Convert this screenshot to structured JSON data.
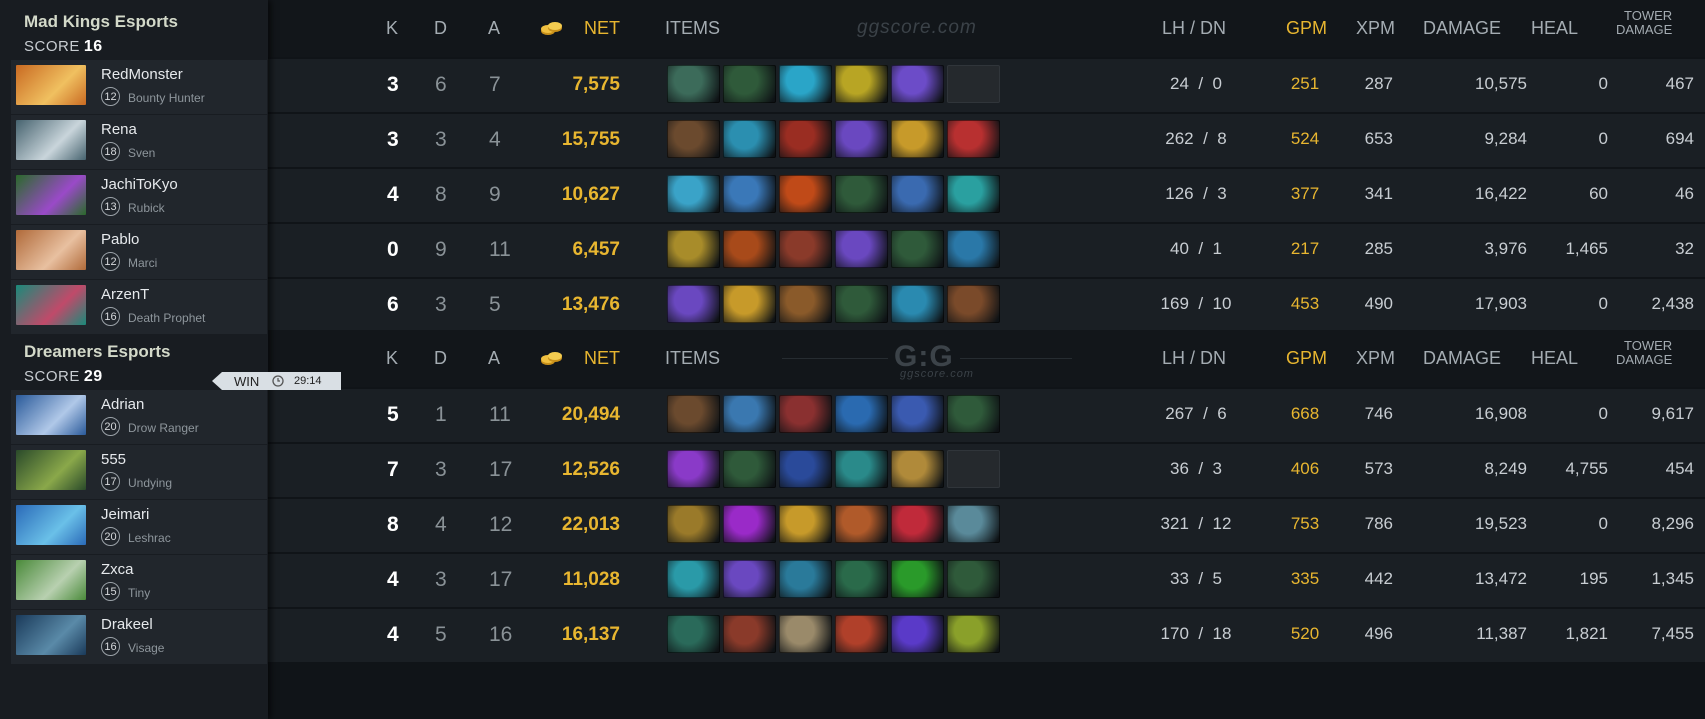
{
  "headers": {
    "k": "K",
    "d": "D",
    "a": "A",
    "net": "NET",
    "items": "ITEMS",
    "lhdn": "LH  /  DN",
    "gpm": "GPM",
    "xpm": "XPM",
    "damage": "DAMAGE",
    "heal": "HEAL",
    "tower1": "TOWER",
    "tower2": "DAMAGE"
  },
  "watermark_top": "ggscore.com",
  "watermark_logo": "G:G",
  "watermark_sub": "ggscore.com",
  "colors": {
    "gold": "#e8b630",
    "background": "#101418",
    "row": "#1a1f24"
  },
  "teams": [
    {
      "name": "Mad Kings Esports",
      "score_label": "SCORE",
      "score": "16",
      "players": [
        {
          "name": "RedMonster",
          "level": "12",
          "hero": "Bounty Hunter",
          "k": "3",
          "d": "6",
          "a": "7",
          "net": "7,575",
          "lh": "24",
          "dn": "0",
          "gpm": "251",
          "xpm": "287",
          "damage": "10,575",
          "heal": "0",
          "tower": "467",
          "items": [
            "#3c6b5a",
            "#2f5a3a",
            "#2aa5c8",
            "#b8a524",
            "#6c4cc8",
            "empty"
          ],
          "portrait": [
            "#c96a22",
            "#f0c060"
          ]
        },
        {
          "name": "Rena",
          "level": "18",
          "hero": "Sven",
          "k": "3",
          "d": "3",
          "a": "4",
          "net": "15,755",
          "lh": "262",
          "dn": "8",
          "gpm": "524",
          "xpm": "653",
          "damage": "9,284",
          "heal": "0",
          "tower": "694",
          "items": [
            "#6b4a2e",
            "#2b8fb0",
            "#9a2d22",
            "#6a48c0",
            "#c79a2a",
            "#b83030"
          ],
          "portrait": [
            "#46636f",
            "#c9d5db"
          ]
        },
        {
          "name": "JachiToKyo",
          "level": "13",
          "hero": "Rubick",
          "k": "4",
          "d": "8",
          "a": "9",
          "net": "10,627",
          "lh": "126",
          "dn": "3",
          "gpm": "377",
          "xpm": "341",
          "damage": "16,422",
          "heal": "60",
          "tower": "46",
          "items": [
            "#3aa3c8",
            "#3a78b8",
            "#c04a18",
            "#2f5a3a",
            "#3a6ab0",
            "#2aa0a0"
          ],
          "portrait": [
            "#2a6a2a",
            "#9a4ac8"
          ]
        },
        {
          "name": "Pablo",
          "level": "12",
          "hero": "Marci",
          "k": "0",
          "d": "9",
          "a": "11",
          "net": "6,457",
          "lh": "40",
          "dn": "1",
          "gpm": "217",
          "xpm": "285",
          "damage": "3,976",
          "heal": "1,465",
          "tower": "32",
          "items": [
            "#a88c2a",
            "#a84a1a",
            "#8a3a2a",
            "#6a48c0",
            "#2f5a3a",
            "#2a78a8"
          ],
          "portrait": [
            "#b06a3a",
            "#e8c0a0"
          ]
        },
        {
          "name": "ArzenT",
          "level": "16",
          "hero": "Death Prophet",
          "k": "6",
          "d": "3",
          "a": "5",
          "net": "13,476",
          "lh": "169",
          "dn": "10",
          "gpm": "453",
          "xpm": "490",
          "damage": "17,903",
          "heal": "0",
          "tower": "2,438",
          "items": [
            "#6a48c0",
            "#c79a2a",
            "#8a5a2a",
            "#2f5a3a",
            "#2a8ab0",
            "#7a4a2a"
          ],
          "portrait": [
            "#1a8a7a",
            "#c04a6a"
          ]
        }
      ]
    },
    {
      "name": "Dreamers Esports",
      "score_label": "SCORE",
      "score": "29",
      "result": "WIN",
      "duration": "29:14",
      "players": [
        {
          "name": "Adrian",
          "level": "20",
          "hero": "Drow Ranger",
          "k": "5",
          "d": "1",
          "a": "11",
          "net": "20,494",
          "lh": "267",
          "dn": "6",
          "gpm": "668",
          "xpm": "746",
          "damage": "16,908",
          "heal": "0",
          "tower": "9,617",
          "items": [
            "#6b4a2e",
            "#3a78b0",
            "#8a3030",
            "#2a6ab0",
            "#3a5ab0",
            "#2f5a3a"
          ],
          "portrait": [
            "#2a5a9a",
            "#b0c8e8"
          ]
        },
        {
          "name": "555",
          "level": "17",
          "hero": "Undying",
          "k": "7",
          "d": "3",
          "a": "17",
          "net": "12,526",
          "lh": "36",
          "dn": "3",
          "gpm": "406",
          "xpm": "573",
          "damage": "8,249",
          "heal": "4,755",
          "tower": "454",
          "items": [
            "#8a3ac8",
            "#2f5a3a",
            "#2a4a9a",
            "#2a8a8a",
            "#b08a3a",
            "empty"
          ],
          "portrait": [
            "#2a4a2a",
            "#8aa84a"
          ]
        },
        {
          "name": "Jeimari",
          "level": "20",
          "hero": "Leshrac",
          "k": "8",
          "d": "4",
          "a": "12",
          "net": "22,013",
          "lh": "321",
          "dn": "12",
          "gpm": "753",
          "xpm": "786",
          "damage": "19,523",
          "heal": "0",
          "tower": "8,296",
          "items": [
            "#9a7a2a",
            "#9a2ac8",
            "#c79a2a",
            "#b05a2a",
            "#c02a3a",
            "#5a8a9a"
          ],
          "portrait": [
            "#2a6ab8",
            "#6ac0e8"
          ]
        },
        {
          "name": "Zxca",
          "level": "15",
          "hero": "Tiny",
          "k": "4",
          "d": "3",
          "a": "17",
          "net": "11,028",
          "lh": "33",
          "dn": "5",
          "gpm": "335",
          "xpm": "442",
          "damage": "13,472",
          "heal": "195",
          "tower": "1,345",
          "items": [
            "#2a9aa8",
            "#6a48c0",
            "#2a7a9a",
            "#2a6a4a",
            "#2a9a2a",
            "#2f5a3a"
          ],
          "portrait": [
            "#4a8a3a",
            "#b8d0b0"
          ]
        },
        {
          "name": "Drakeel",
          "level": "16",
          "hero": "Visage",
          "k": "4",
          "d": "5",
          "a": "16",
          "net": "16,137",
          "lh": "170",
          "dn": "18",
          "gpm": "520",
          "xpm": "496",
          "damage": "11,387",
          "heal": "1,821",
          "tower": "7,455",
          "items": [
            "#2a6a5a",
            "#8a3a2a",
            "#9a8a6a",
            "#b0402a",
            "#5a3ac8",
            "#8aa02a"
          ],
          "portrait": [
            "#1a3a5a",
            "#5a8aa8"
          ]
        }
      ]
    }
  ]
}
